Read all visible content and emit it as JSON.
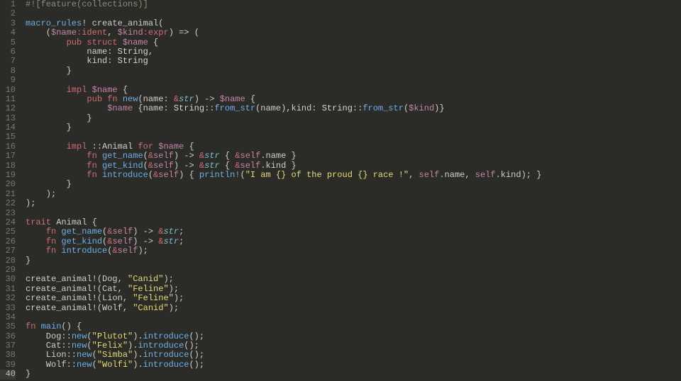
{
  "editor": {
    "active_line": 40,
    "lines": [
      {
        "n": 1,
        "tokens": [
          [
            "c-attr",
            "#![feature(collections)]"
          ]
        ]
      },
      {
        "n": 2,
        "tokens": []
      },
      {
        "n": 3,
        "tokens": [
          [
            "c-macro",
            "macro_rules"
          ],
          [
            "c-punct",
            "! "
          ],
          [
            "c-default",
            "create_animal("
          ]
        ]
      },
      {
        "n": 4,
        "tokens": [
          [
            "c-default",
            "    ("
          ],
          [
            "c-mvar",
            "$name"
          ],
          [
            "c-meta",
            ":ident"
          ],
          [
            "c-default",
            ", "
          ],
          [
            "c-mvar",
            "$kind"
          ],
          [
            "c-meta",
            ":expr"
          ],
          [
            "c-default",
            ") => ("
          ]
        ]
      },
      {
        "n": 5,
        "tokens": [
          [
            "c-default",
            "        "
          ],
          [
            "c-kw",
            "pub struct"
          ],
          [
            "c-default",
            " "
          ],
          [
            "c-mvar",
            "$name"
          ],
          [
            "c-default",
            " {"
          ]
        ]
      },
      {
        "n": 6,
        "tokens": [
          [
            "c-default",
            "            name: "
          ],
          [
            "c-type2",
            "String"
          ],
          [
            "c-default",
            ","
          ]
        ]
      },
      {
        "n": 7,
        "tokens": [
          [
            "c-default",
            "            kind: "
          ],
          [
            "c-type2",
            "String"
          ]
        ]
      },
      {
        "n": 8,
        "tokens": [
          [
            "c-default",
            "        }"
          ]
        ]
      },
      {
        "n": 9,
        "tokens": []
      },
      {
        "n": 10,
        "tokens": [
          [
            "c-default",
            "        "
          ],
          [
            "c-kw",
            "impl"
          ],
          [
            "c-default",
            " "
          ],
          [
            "c-mvar",
            "$name"
          ],
          [
            "c-default",
            " {"
          ]
        ]
      },
      {
        "n": 11,
        "tokens": [
          [
            "c-default",
            "            "
          ],
          [
            "c-kw",
            "pub fn"
          ],
          [
            "c-default",
            " "
          ],
          [
            "c-fn",
            "new"
          ],
          [
            "c-default",
            "(name: "
          ],
          [
            "c-amp",
            "&"
          ],
          [
            "c-type",
            "str"
          ],
          [
            "c-default",
            ") -> "
          ],
          [
            "c-mvar",
            "$name"
          ],
          [
            "c-default",
            " {"
          ]
        ]
      },
      {
        "n": 12,
        "tokens": [
          [
            "c-default",
            "                "
          ],
          [
            "c-mvar",
            "$name"
          ],
          [
            "c-default",
            " {name: "
          ],
          [
            "c-type2",
            "String"
          ],
          [
            "c-default",
            "::"
          ],
          [
            "c-fn",
            "from_str"
          ],
          [
            "c-default",
            "(name),kind: "
          ],
          [
            "c-type2",
            "String"
          ],
          [
            "c-default",
            "::"
          ],
          [
            "c-fn",
            "from_str"
          ],
          [
            "c-default",
            "("
          ],
          [
            "c-mvar",
            "$kind"
          ],
          [
            "c-default",
            ")}"
          ]
        ]
      },
      {
        "n": 13,
        "tokens": [
          [
            "c-default",
            "            }"
          ]
        ]
      },
      {
        "n": 14,
        "tokens": [
          [
            "c-default",
            "        }"
          ]
        ]
      },
      {
        "n": 15,
        "tokens": []
      },
      {
        "n": 16,
        "tokens": [
          [
            "c-default",
            "        "
          ],
          [
            "c-kw",
            "impl"
          ],
          [
            "c-default",
            " ::Animal "
          ],
          [
            "c-kw",
            "for"
          ],
          [
            "c-default",
            " "
          ],
          [
            "c-mvar",
            "$name"
          ],
          [
            "c-default",
            " {"
          ]
        ]
      },
      {
        "n": 17,
        "tokens": [
          [
            "c-default",
            "            "
          ],
          [
            "c-kw",
            "fn"
          ],
          [
            "c-default",
            " "
          ],
          [
            "c-fn",
            "get_name"
          ],
          [
            "c-default",
            "("
          ],
          [
            "c-amp",
            "&"
          ],
          [
            "c-self",
            "self"
          ],
          [
            "c-default",
            ") -> "
          ],
          [
            "c-amp",
            "&"
          ],
          [
            "c-type",
            "str"
          ],
          [
            "c-default",
            " { "
          ],
          [
            "c-amp",
            "&"
          ],
          [
            "c-self",
            "self"
          ],
          [
            "c-default",
            ".name }"
          ]
        ]
      },
      {
        "n": 18,
        "tokens": [
          [
            "c-default",
            "            "
          ],
          [
            "c-kw",
            "fn"
          ],
          [
            "c-default",
            " "
          ],
          [
            "c-fn",
            "get_kind"
          ],
          [
            "c-default",
            "("
          ],
          [
            "c-amp",
            "&"
          ],
          [
            "c-self",
            "self"
          ],
          [
            "c-default",
            ") -> "
          ],
          [
            "c-amp",
            "&"
          ],
          [
            "c-type",
            "str"
          ],
          [
            "c-default",
            " { "
          ],
          [
            "c-amp",
            "&"
          ],
          [
            "c-self",
            "self"
          ],
          [
            "c-default",
            ".kind }"
          ]
        ]
      },
      {
        "n": 19,
        "tokens": [
          [
            "c-default",
            "            "
          ],
          [
            "c-kw",
            "fn"
          ],
          [
            "c-default",
            " "
          ],
          [
            "c-fn",
            "introduce"
          ],
          [
            "c-default",
            "("
          ],
          [
            "c-amp",
            "&"
          ],
          [
            "c-self",
            "self"
          ],
          [
            "c-default",
            ") { "
          ],
          [
            "c-macro",
            "println!"
          ],
          [
            "c-default",
            "("
          ],
          [
            "c-str",
            "\"I am {} of the proud {} race !\""
          ],
          [
            "c-default",
            ", "
          ],
          [
            "c-self",
            "self"
          ],
          [
            "c-default",
            ".name, "
          ],
          [
            "c-self",
            "self"
          ],
          [
            "c-default",
            ".kind); }"
          ]
        ]
      },
      {
        "n": 20,
        "tokens": [
          [
            "c-default",
            "        }"
          ]
        ]
      },
      {
        "n": 21,
        "tokens": [
          [
            "c-default",
            "    );"
          ]
        ]
      },
      {
        "n": 22,
        "tokens": [
          [
            "c-default",
            ");"
          ]
        ]
      },
      {
        "n": 23,
        "tokens": []
      },
      {
        "n": 24,
        "tokens": [
          [
            "c-kw",
            "trait"
          ],
          [
            "c-default",
            " Animal {"
          ]
        ]
      },
      {
        "n": 25,
        "tokens": [
          [
            "c-default",
            "    "
          ],
          [
            "c-kw",
            "fn"
          ],
          [
            "c-default",
            " "
          ],
          [
            "c-fn",
            "get_name"
          ],
          [
            "c-default",
            "("
          ],
          [
            "c-amp",
            "&"
          ],
          [
            "c-self",
            "self"
          ],
          [
            "c-default",
            ") -> "
          ],
          [
            "c-amp",
            "&"
          ],
          [
            "c-type",
            "str"
          ],
          [
            "c-default",
            ";"
          ]
        ]
      },
      {
        "n": 26,
        "tokens": [
          [
            "c-default",
            "    "
          ],
          [
            "c-kw",
            "fn"
          ],
          [
            "c-default",
            " "
          ],
          [
            "c-fn",
            "get_kind"
          ],
          [
            "c-default",
            "("
          ],
          [
            "c-amp",
            "&"
          ],
          [
            "c-self",
            "self"
          ],
          [
            "c-default",
            ") -> "
          ],
          [
            "c-amp",
            "&"
          ],
          [
            "c-type",
            "str"
          ],
          [
            "c-default",
            ";"
          ]
        ]
      },
      {
        "n": 27,
        "tokens": [
          [
            "c-default",
            "    "
          ],
          [
            "c-kw",
            "fn"
          ],
          [
            "c-default",
            " "
          ],
          [
            "c-fn",
            "introduce"
          ],
          [
            "c-default",
            "("
          ],
          [
            "c-amp",
            "&"
          ],
          [
            "c-self",
            "self"
          ],
          [
            "c-default",
            ");"
          ]
        ]
      },
      {
        "n": 28,
        "tokens": [
          [
            "c-default",
            "}"
          ]
        ]
      },
      {
        "n": 29,
        "tokens": []
      },
      {
        "n": 30,
        "tokens": [
          [
            "c-default",
            "create_animal!(Dog, "
          ],
          [
            "c-str",
            "\"Canid\""
          ],
          [
            "c-default",
            ");"
          ]
        ]
      },
      {
        "n": 31,
        "tokens": [
          [
            "c-default",
            "create_animal!(Cat, "
          ],
          [
            "c-str",
            "\"Feline\""
          ],
          [
            "c-default",
            ");"
          ]
        ]
      },
      {
        "n": 32,
        "tokens": [
          [
            "c-default",
            "create_animal!(Lion, "
          ],
          [
            "c-str",
            "\"Feline\""
          ],
          [
            "c-default",
            ");"
          ]
        ]
      },
      {
        "n": 33,
        "tokens": [
          [
            "c-default",
            "create_animal!(Wolf, "
          ],
          [
            "c-str",
            "\"Canid\""
          ],
          [
            "c-default",
            ");"
          ]
        ]
      },
      {
        "n": 34,
        "tokens": []
      },
      {
        "n": 35,
        "tokens": [
          [
            "c-kw",
            "fn"
          ],
          [
            "c-default",
            " "
          ],
          [
            "c-fn",
            "main"
          ],
          [
            "c-default",
            "() {"
          ]
        ]
      },
      {
        "n": 36,
        "tokens": [
          [
            "c-default",
            "    Dog::"
          ],
          [
            "c-call",
            "new"
          ],
          [
            "c-default",
            "("
          ],
          [
            "c-str",
            "\"Plutot\""
          ],
          [
            "c-default",
            ")."
          ],
          [
            "c-call",
            "introduce"
          ],
          [
            "c-default",
            "();"
          ]
        ]
      },
      {
        "n": 37,
        "tokens": [
          [
            "c-default",
            "    Cat::"
          ],
          [
            "c-call",
            "new"
          ],
          [
            "c-default",
            "("
          ],
          [
            "c-str",
            "\"Felix\""
          ],
          [
            "c-default",
            ")."
          ],
          [
            "c-call",
            "introduce"
          ],
          [
            "c-default",
            "();"
          ]
        ]
      },
      {
        "n": 38,
        "tokens": [
          [
            "c-default",
            "    Lion::"
          ],
          [
            "c-call",
            "new"
          ],
          [
            "c-default",
            "("
          ],
          [
            "c-str",
            "\"Simba\""
          ],
          [
            "c-default",
            ")."
          ],
          [
            "c-call",
            "introduce"
          ],
          [
            "c-default",
            "();"
          ]
        ]
      },
      {
        "n": 39,
        "tokens": [
          [
            "c-default",
            "    Wolf::"
          ],
          [
            "c-call",
            "new"
          ],
          [
            "c-default",
            "("
          ],
          [
            "c-str",
            "\"Wolfi\""
          ],
          [
            "c-default",
            ")."
          ],
          [
            "c-call",
            "introduce"
          ],
          [
            "c-default",
            "();"
          ]
        ]
      },
      {
        "n": 40,
        "tokens": [
          [
            "c-default",
            "}"
          ]
        ]
      }
    ]
  }
}
